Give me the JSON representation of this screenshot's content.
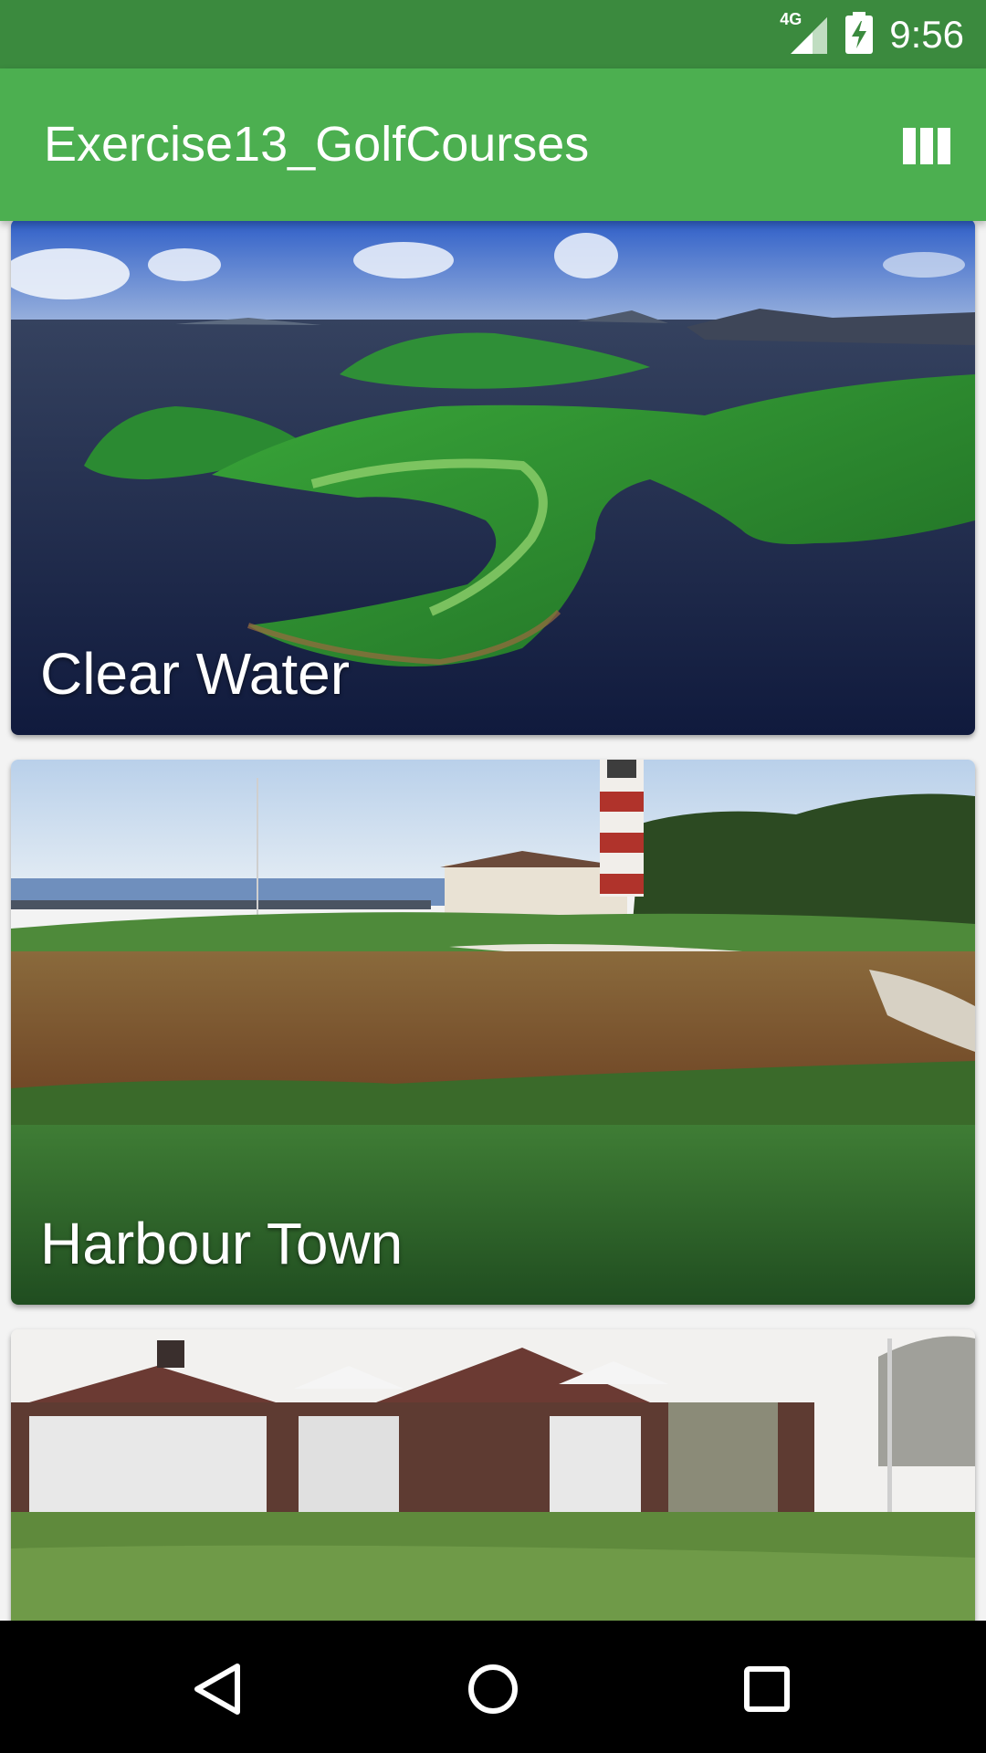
{
  "status_bar": {
    "network": "4G",
    "time": "9:56",
    "icons": [
      "signal-icon",
      "battery-charging-icon"
    ]
  },
  "app_bar": {
    "title": "Exercise13_GolfCourses",
    "action_icon": "view-column-icon"
  },
  "courses": [
    {
      "name": "Clear Water"
    },
    {
      "name": "Harbour Town"
    },
    {
      "name": ""
    }
  ],
  "nav_bar": {
    "icons": [
      "back-icon",
      "home-icon",
      "recents-icon"
    ]
  },
  "colors": {
    "status_bar": "#3b8a3e",
    "app_bar": "#4caf50",
    "nav_bar": "#000000"
  }
}
